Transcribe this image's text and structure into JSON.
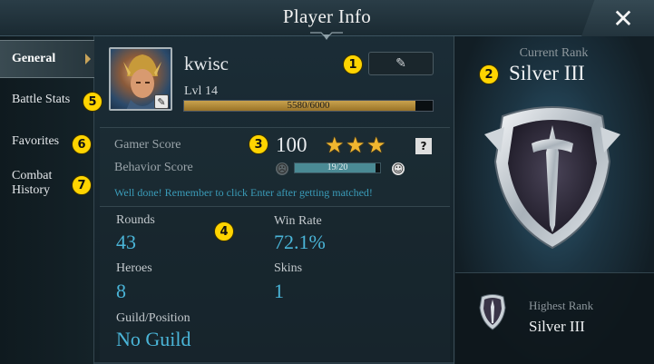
{
  "window": {
    "title": "Player Info",
    "close_icon": "close-x-icon"
  },
  "sidebar": {
    "items": [
      {
        "label": "General",
        "active": true
      },
      {
        "label": "Battle Stats",
        "active": false
      },
      {
        "label": "Favorites",
        "active": false
      },
      {
        "label": "Combat History",
        "active": false
      }
    ]
  },
  "profile": {
    "name": "kwisc",
    "level": "Lvl 14",
    "xp_text": "5580/6000",
    "xp_fraction": 0.93,
    "edit_icon": "pencil-icon"
  },
  "scores": {
    "gamer_label": "Gamer Score",
    "gamer_value": "100",
    "stars": 3,
    "help": "?",
    "behavior_label": "Behavior Score",
    "behavior_text": "19/20",
    "behavior_fraction": 0.95,
    "message": "Well done! Remember to click Enter after getting matched!"
  },
  "stats": {
    "rounds_label": "Rounds",
    "rounds_value": "43",
    "winrate_label": "Win Rate",
    "winrate_value": "72.1%",
    "heroes_label": "Heroes",
    "heroes_value": "8",
    "skins_label": "Skins",
    "skins_value": "1",
    "guild_label": "Guild/Position",
    "guild_value": "No Guild"
  },
  "rank": {
    "current_label": "Current Rank",
    "current_value": "Silver III",
    "highest_label": "Highest Rank",
    "highest_value": "Silver III"
  },
  "badges": [
    "1",
    "2",
    "3",
    "4",
    "5",
    "6",
    "7"
  ],
  "colors": {
    "accent": "#ffd400",
    "stat_value": "#4ab5d8",
    "star": "#f1b62f",
    "message": "#3a9bb8"
  }
}
